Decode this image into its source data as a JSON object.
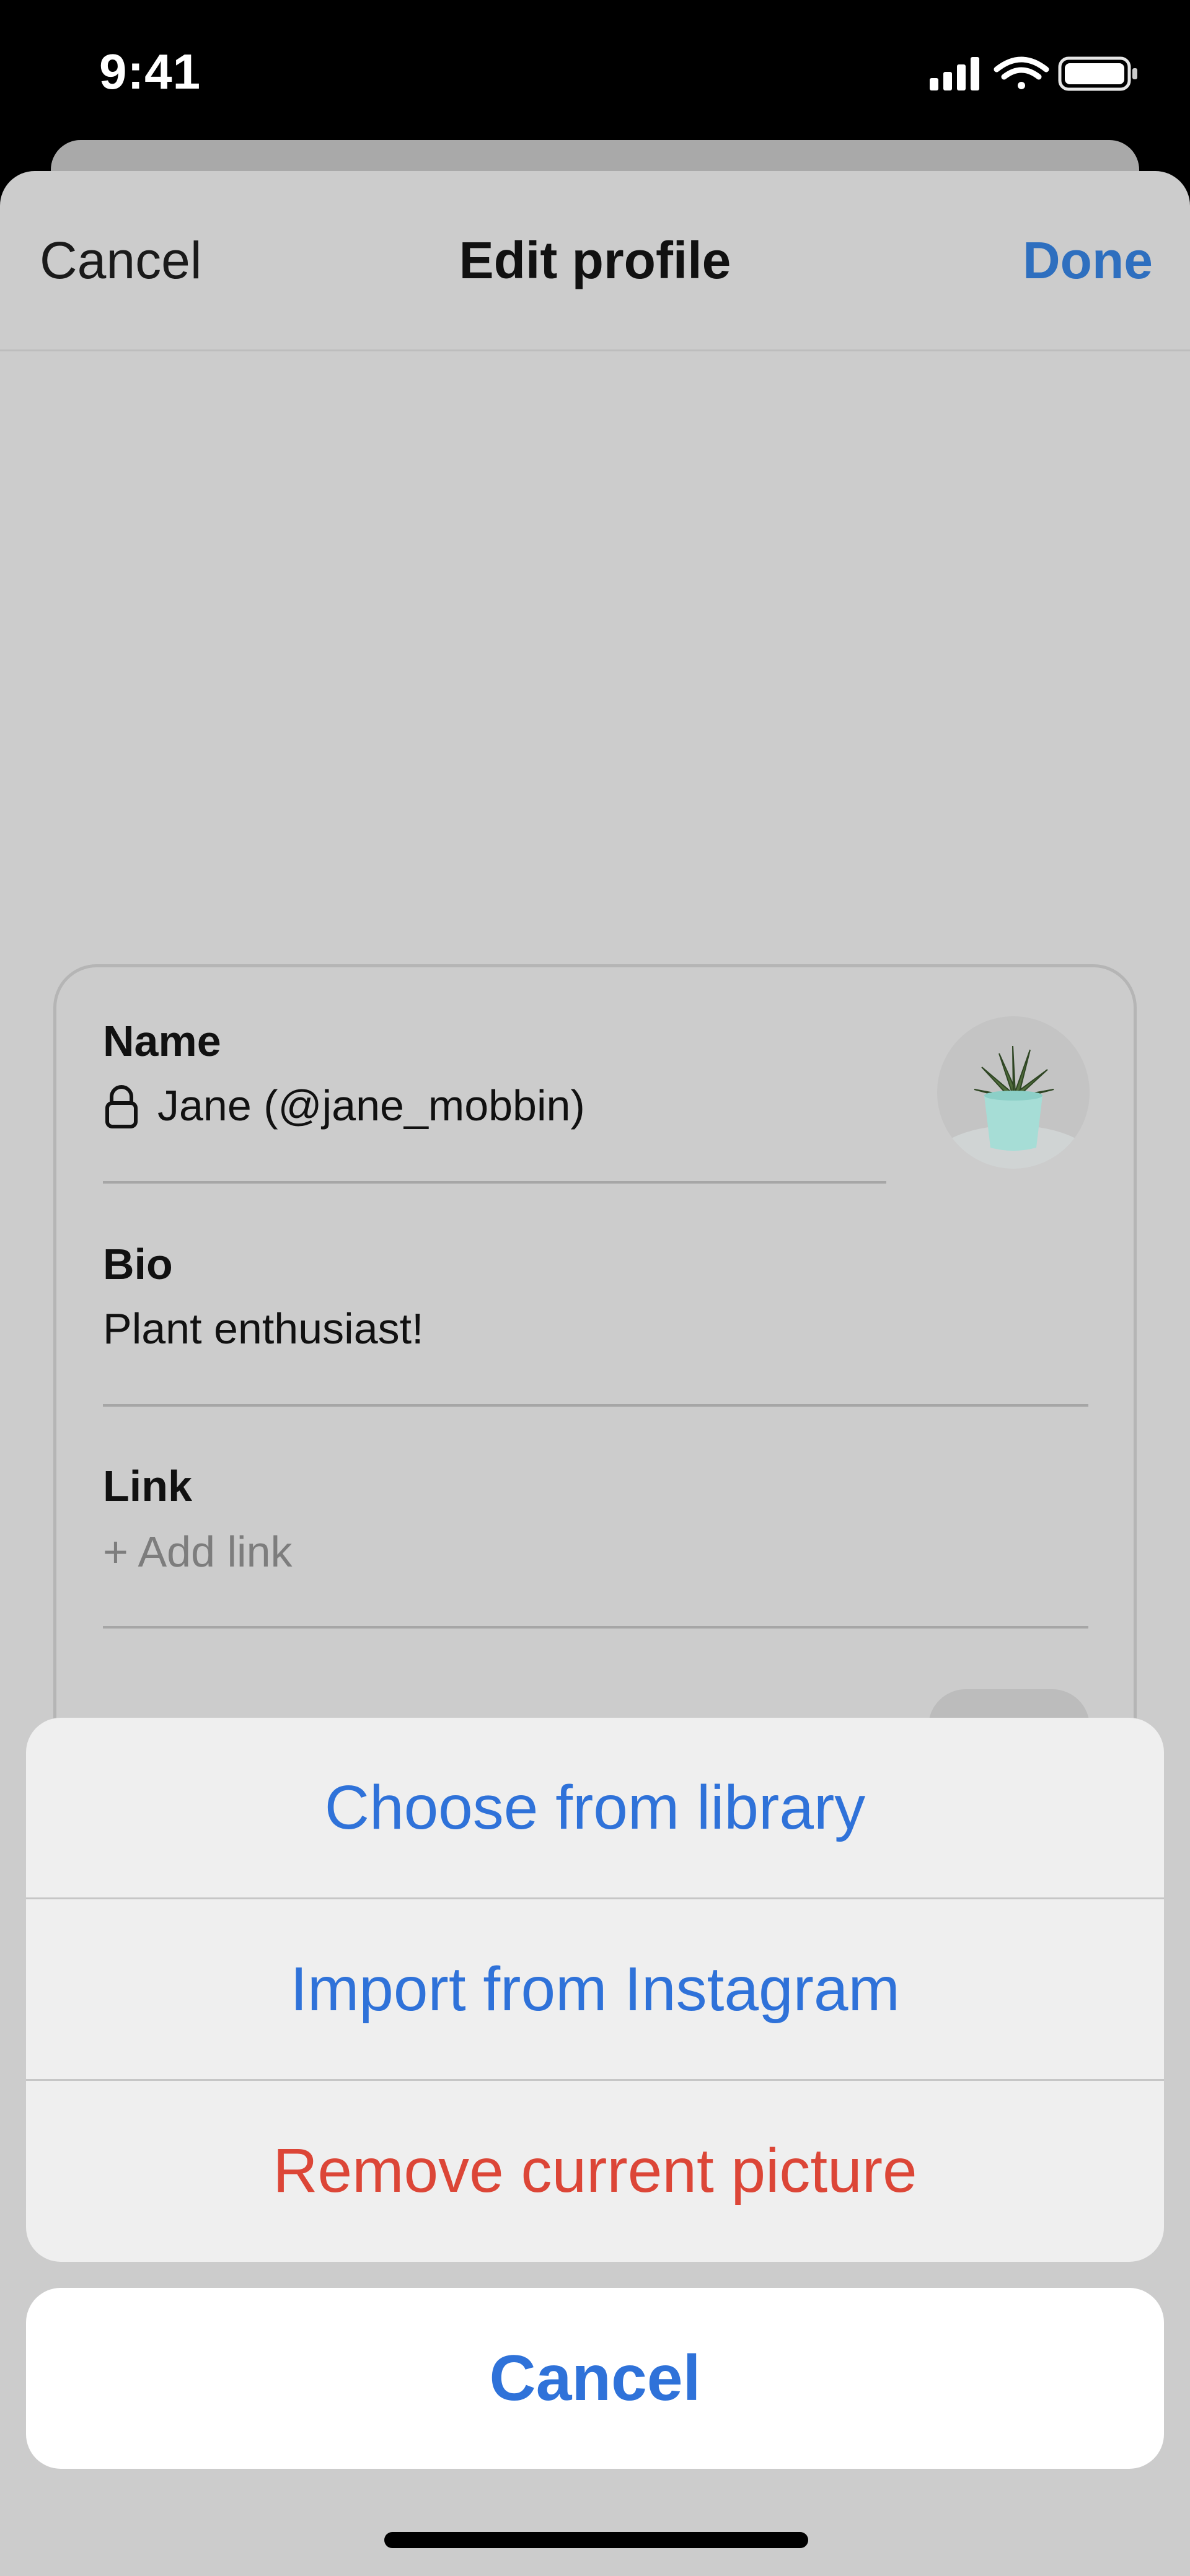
{
  "status_bar": {
    "time": "9:41",
    "icons": [
      "signal-icon",
      "wifi-icon",
      "battery-icon"
    ]
  },
  "nav": {
    "cancel_label": "Cancel",
    "title": "Edit profile",
    "done_label": "Done"
  },
  "profile": {
    "name_label": "Name",
    "name_value": "Jane (@jane_mobbin)",
    "bio_label": "Bio",
    "bio_value": "Plant enthusiast!",
    "link_label": "Link",
    "link_placeholder": "+ Add link"
  },
  "action_sheet": {
    "items": [
      {
        "label": "Choose from library",
        "style": "default"
      },
      {
        "label": "Import from Instagram",
        "style": "default"
      },
      {
        "label": "Remove current picture",
        "style": "destructive"
      }
    ],
    "cancel_label": "Cancel"
  },
  "colors": {
    "accent": "#2f72d9",
    "destructive": "#dc4637",
    "sheet_bg": "#cccccc"
  }
}
